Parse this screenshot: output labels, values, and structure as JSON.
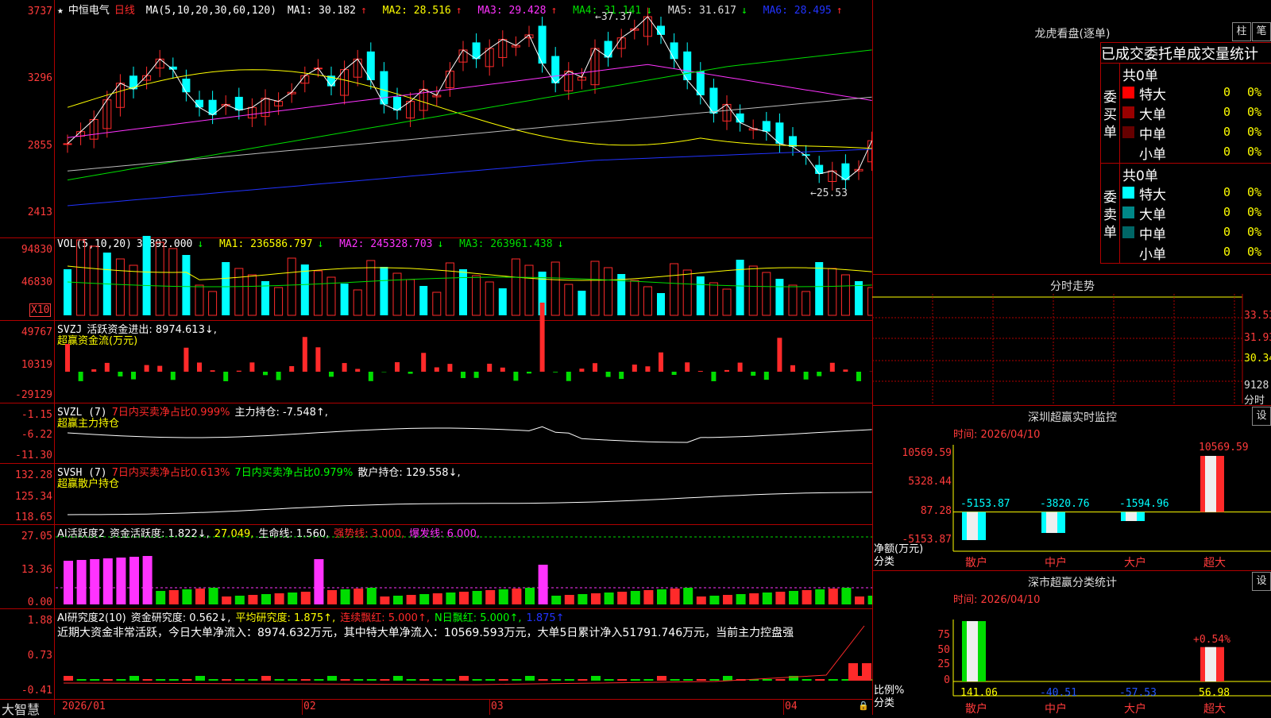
{
  "app": {
    "logo": "大智慧"
  },
  "colors": {
    "up": "#ff2a2a",
    "down": "#00ffff",
    "ma1": "#ffffff",
    "ma2": "#ffff00",
    "ma3": "#ff33ff",
    "ma4": "#00dd00",
    "ma5": "#bbbbbb",
    "ma6": "#2233ff",
    "grid": "#b00000"
  },
  "price_panel": {
    "star": "★",
    "stock_name": "中恒电气",
    "period": "日线",
    "ma_label": "MA(5,10,20,30,60,120)",
    "ma_values": [
      {
        "text": "MA1: 30.182",
        "arrow": "↑"
      },
      {
        "text": "MA2: 28.516",
        "arrow": "↑"
      },
      {
        "text": "MA3: 29.428",
        "arrow": "↑"
      },
      {
        "text": "MA4: 31.141",
        "arrow": "↓"
      },
      {
        "text": "MA5: 31.617",
        "arrow": "↓"
      },
      {
        "text": "MA6: 28.495",
        "arrow": "↑"
      }
    ],
    "y_ticks": [
      "3737",
      "3296",
      "2855",
      "2413"
    ],
    "high_note": "37.37",
    "low_note": "25.53"
  },
  "vol_panel": {
    "title": "VOL(5,10,20)",
    "values": [
      {
        "text": "33892.000",
        "arrow": "↓"
      },
      {
        "text": "MA1: 236586.797",
        "arrow": "↓"
      },
      {
        "text": "MA2: 245328.703",
        "arrow": "↓"
      },
      {
        "text": "MA3: 263961.438",
        "arrow": "↓"
      }
    ],
    "y_ticks": [
      "94830",
      "46830"
    ],
    "unit": "X10"
  },
  "svzj_panel": {
    "title": "SVZJ",
    "value": "活跃资金进出: 8974.613↓,",
    "subtitle": "超赢资金流(万元)",
    "y_ticks": [
      "49767",
      "10319",
      "-29129"
    ]
  },
  "svzl_panel": {
    "title": "SVZL (7)",
    "item1": "7日内买卖净占比0.999%",
    "item2": "主力持仓: -7.548↑,",
    "subtitle": "超赢主力持仓",
    "y_ticks": [
      "-1.15",
      "-6.22",
      "-11.30"
    ]
  },
  "svsh_panel": {
    "title": "SVSH (7)",
    "item1": "7日内买卖净占比0.613%",
    "item2": "7日内买卖净占比0.979%",
    "item3": "散户持仓: 129.558↓,",
    "subtitle": "超赢散户持仓",
    "y_ticks": [
      "132.28",
      "125.34",
      "118.65"
    ]
  },
  "ai2_panel": {
    "title": "AI活跃度2",
    "item1": "资金活跃度: 1.822↓,",
    "item2": "27.049,",
    "item3": "生命线: 1.560,",
    "item4": "强势线: 3.000,",
    "item5": "爆发线: 6.000,",
    "y_ticks": [
      "27.05",
      "13.36",
      "0.00"
    ]
  },
  "ai_research_panel": {
    "title": "AI研究度2(10)",
    "item1": "资金研究度: 0.562↓,",
    "item2": "平均研究度: 1.875↑,",
    "item3": "连续飘红: 5.000↑,",
    "item4": "N日飘红: 5.000↑,",
    "item5": "1.875↑",
    "summary": "近期大资金非常活跃，今日大单净流入：8974.632万元，其中特大单净流入：10569.593万元，大单5日累计净入51791.746万元，当前主力控盘强",
    "y_ticks": [
      "1.88",
      "0.73",
      "-0.41"
    ]
  },
  "x_axis": {
    "labels": [
      "2026/01",
      "02",
      "03",
      "04"
    ]
  },
  "dragon_tiger": {
    "title": "龙虎看盘(逐单)",
    "btn_bar": "柱",
    "btn_pen": "笔",
    "header": "已成交委托单成交量统计",
    "buy_label": "委买单",
    "sell_label": "委卖单",
    "buy_total": "共0单",
    "sell_total": "共0单",
    "buy_rows": [
      {
        "name": "特大",
        "count": "0",
        "pct": "0%",
        "color": "#ff0000"
      },
      {
        "name": "大单",
        "count": "0",
        "pct": "0%",
        "color": "#990000"
      },
      {
        "name": "中单",
        "count": "0",
        "pct": "0%",
        "color": "#660000"
      },
      {
        "name": "小单",
        "count": "0",
        "pct": "0%",
        "color": "#000000"
      }
    ],
    "sell_rows": [
      {
        "name": "特大",
        "count": "0",
        "pct": "0%",
        "color": "#00ffff"
      },
      {
        "name": "大单",
        "count": "0",
        "pct": "0%",
        "color": "#008888"
      },
      {
        "name": "中单",
        "count": "0",
        "pct": "0%",
        "color": "#006666"
      },
      {
        "name": "小单",
        "count": "0",
        "pct": "0%",
        "color": "#000000"
      }
    ]
  },
  "intraday": {
    "title": "分时走势",
    "right_labels": [
      "33.53",
      "31.93",
      "30.34",
      "9128"
    ],
    "unit_label": "分时"
  },
  "sz_monitor": {
    "title": "深圳超赢实时监控",
    "settings": "设",
    "time_label": "时间: 2026/04/10",
    "y_ticks": [
      "10569.59",
      "5328.44",
      "87.28",
      "-5153.87"
    ],
    "axis_label_1": "净额(万元)",
    "axis_label_2": "分类",
    "bars": [
      {
        "cat": "散户",
        "value": -5153.87,
        "label": "-5153.87"
      },
      {
        "cat": "中户",
        "value": -3820.76,
        "label": "-3820.76"
      },
      {
        "cat": "大户",
        "value": -1594.96,
        "label": "-1594.96"
      },
      {
        "cat": "超大",
        "value": 10569.59,
        "label": "10569.59"
      }
    ]
  },
  "sz_classify": {
    "title": "深市超赢分类统计",
    "settings": "设",
    "time_label": "时间: 2026/04/10",
    "y_ticks": [
      "75",
      "50",
      "25",
      "0"
    ],
    "axis_label_1": "比例%",
    "axis_label_2": "分类",
    "pct_note": "+0.54%",
    "bars": [
      {
        "cat": "散户",
        "value": 141.06,
        "label": "141.06"
      },
      {
        "cat": "中户",
        "value": -40.51,
        "label": "-40.51"
      },
      {
        "cat": "大户",
        "value": -57.53,
        "label": "-57.53"
      },
      {
        "cat": "超大",
        "value": 56.98,
        "label": "56.98"
      }
    ]
  },
  "chart_data": [
    {
      "type": "bar",
      "title": "深圳超赢实时监控",
      "categories": [
        "散户",
        "中户",
        "大户",
        "超大"
      ],
      "values": [
        -5153.87,
        -3820.76,
        -1594.96,
        10569.59
      ],
      "ylabel": "净额(万元)",
      "xlabel": "分类",
      "ylim": [
        -5153.87,
        10569.59
      ]
    },
    {
      "type": "bar",
      "title": "深市超赢分类统计",
      "categories": [
        "散户",
        "中户",
        "大户",
        "超大"
      ],
      "values": [
        141.06,
        -40.51,
        -57.53,
        56.98
      ],
      "ylabel": "比例%",
      "xlabel": "分类",
      "ylim": [
        0,
        75
      ]
    },
    {
      "type": "candlestick",
      "title": "中恒电气 日线",
      "y_ticks": [
        37.37,
        32.96,
        28.55,
        24.13
      ],
      "high": 37.37,
      "low": 25.53,
      "x_labels": [
        "2026/01",
        "02",
        "03",
        "04"
      ]
    }
  ]
}
